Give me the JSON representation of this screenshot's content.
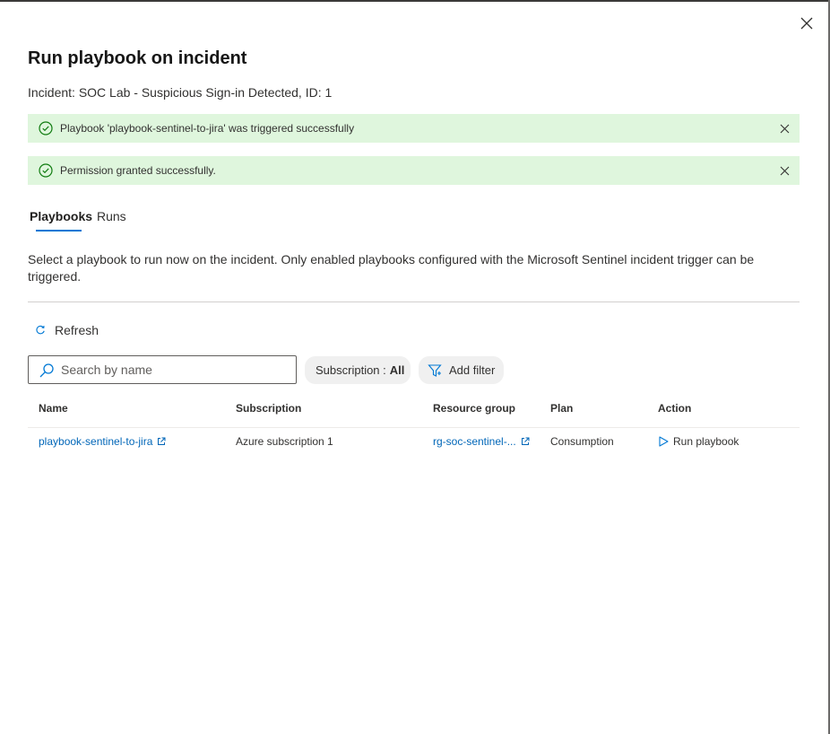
{
  "panel": {
    "title": "Run playbook on incident",
    "incident_info": "Incident: SOC Lab - Suspicious Sign-in Detected, ID: 1"
  },
  "notifications": [
    {
      "message": "Playbook 'playbook-sentinel-to-jira' was triggered successfully",
      "status": "success"
    },
    {
      "message": "Permission granted successfully.",
      "status": "success"
    }
  ],
  "tabs": [
    {
      "label": "Playbooks",
      "active": true
    },
    {
      "label": "Runs",
      "active": false
    }
  ],
  "description": "Select a playbook to run now on the incident. Only enabled playbooks configured with the Microsoft Sentinel incident trigger can be triggered.",
  "toolbar": {
    "refresh_label": "Refresh",
    "refresh_icon": "refresh-icon"
  },
  "filters": {
    "search_placeholder": "Search by name",
    "search_value": "",
    "subscription_label": "Subscription :",
    "subscription_value": "All",
    "add_filter_label": "Add filter"
  },
  "table": {
    "columns": [
      "Name",
      "Subscription",
      "Resource group",
      "Plan",
      "Action"
    ],
    "rows": [
      {
        "name": "playbook-sentinel-to-jira",
        "subscription": "Azure subscription 1",
        "resource_group": "rg-soc-sentinel-...",
        "plan": "Consumption",
        "action": "Run playbook"
      }
    ]
  },
  "colors": {
    "accent": "#0078d4",
    "link": "#0066b8",
    "success_bg": "#dff6dd",
    "success_icon": "#107c10"
  }
}
